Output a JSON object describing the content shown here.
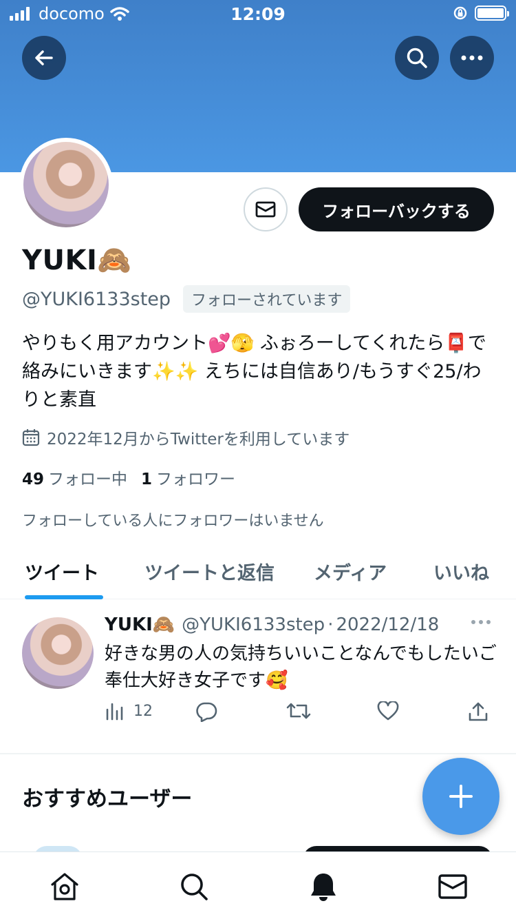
{
  "status_bar": {
    "carrier": "docomo",
    "time": "12:09"
  },
  "header": {
    "back_icon": "arrow-left-icon",
    "search_icon": "search-icon",
    "more_icon": "more-horizontal-icon",
    "banner_color": "#4a90d9"
  },
  "profile": {
    "name": "YUKI🙈",
    "handle": "@YUKI6133step",
    "follows_you_badge": "フォローされています",
    "follow_back_label": "フォローバックする",
    "bio": "やりもく用アカウント💕🫣 ふぉろーしてくれたら📮で絡みにいきます✨✨ えちには自信あり/もうすぐ25/わりと素直",
    "joined": "2022年12月からTwitterを利用しています",
    "following_count": "49",
    "following_label": "フォロー中",
    "followers_count": "1",
    "followers_label": "フォロワー",
    "mutual_note": "フォローしている人にフォロワーはいません"
  },
  "tabs": [
    {
      "label": "ツイート",
      "active": true
    },
    {
      "label": "ツイートと返信",
      "active": false
    },
    {
      "label": "メディア",
      "active": false
    },
    {
      "label": "いいね",
      "active": false
    }
  ],
  "tweet": {
    "name": "YUKI🙈",
    "handle": "@YUKI6133step",
    "separator": "·",
    "date": "2022/12/18",
    "text": "好きな男の人の気持ちいいことなんでもしたいご奉仕大好き女子です🥰",
    "views": "12"
  },
  "recommended": {
    "title": "おすすめユーザー"
  },
  "colors": {
    "accent": "#1d9bf0",
    "fab": "#4a99e9",
    "text_primary": "#0f1419",
    "text_secondary": "#536471"
  }
}
